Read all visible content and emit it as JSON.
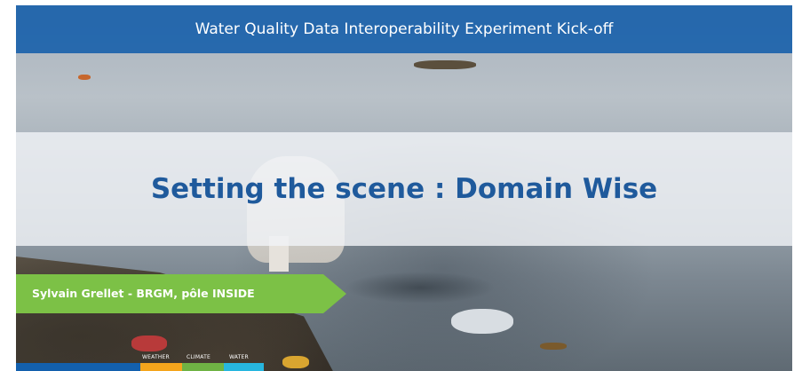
{
  "slide": {
    "header_title": "Water Quality Data Interoperability Experiment Kick-off",
    "main_title": "Setting the scene : Domain Wise",
    "presenter": "Sylvain Grellet -  BRGM, pôle INSIDE",
    "footer_labels": [
      "WEATHER",
      "CLIMATE",
      "WATER"
    ]
  },
  "colors": {
    "header_band": "#135DAA",
    "title_text": "#1F5A9C",
    "presenter_tag": "#7CC146",
    "strip_blue": "#1360AD",
    "strip_orange": "#F5A51C",
    "strip_green": "#6FB344",
    "strip_cyan": "#27B6DF"
  }
}
